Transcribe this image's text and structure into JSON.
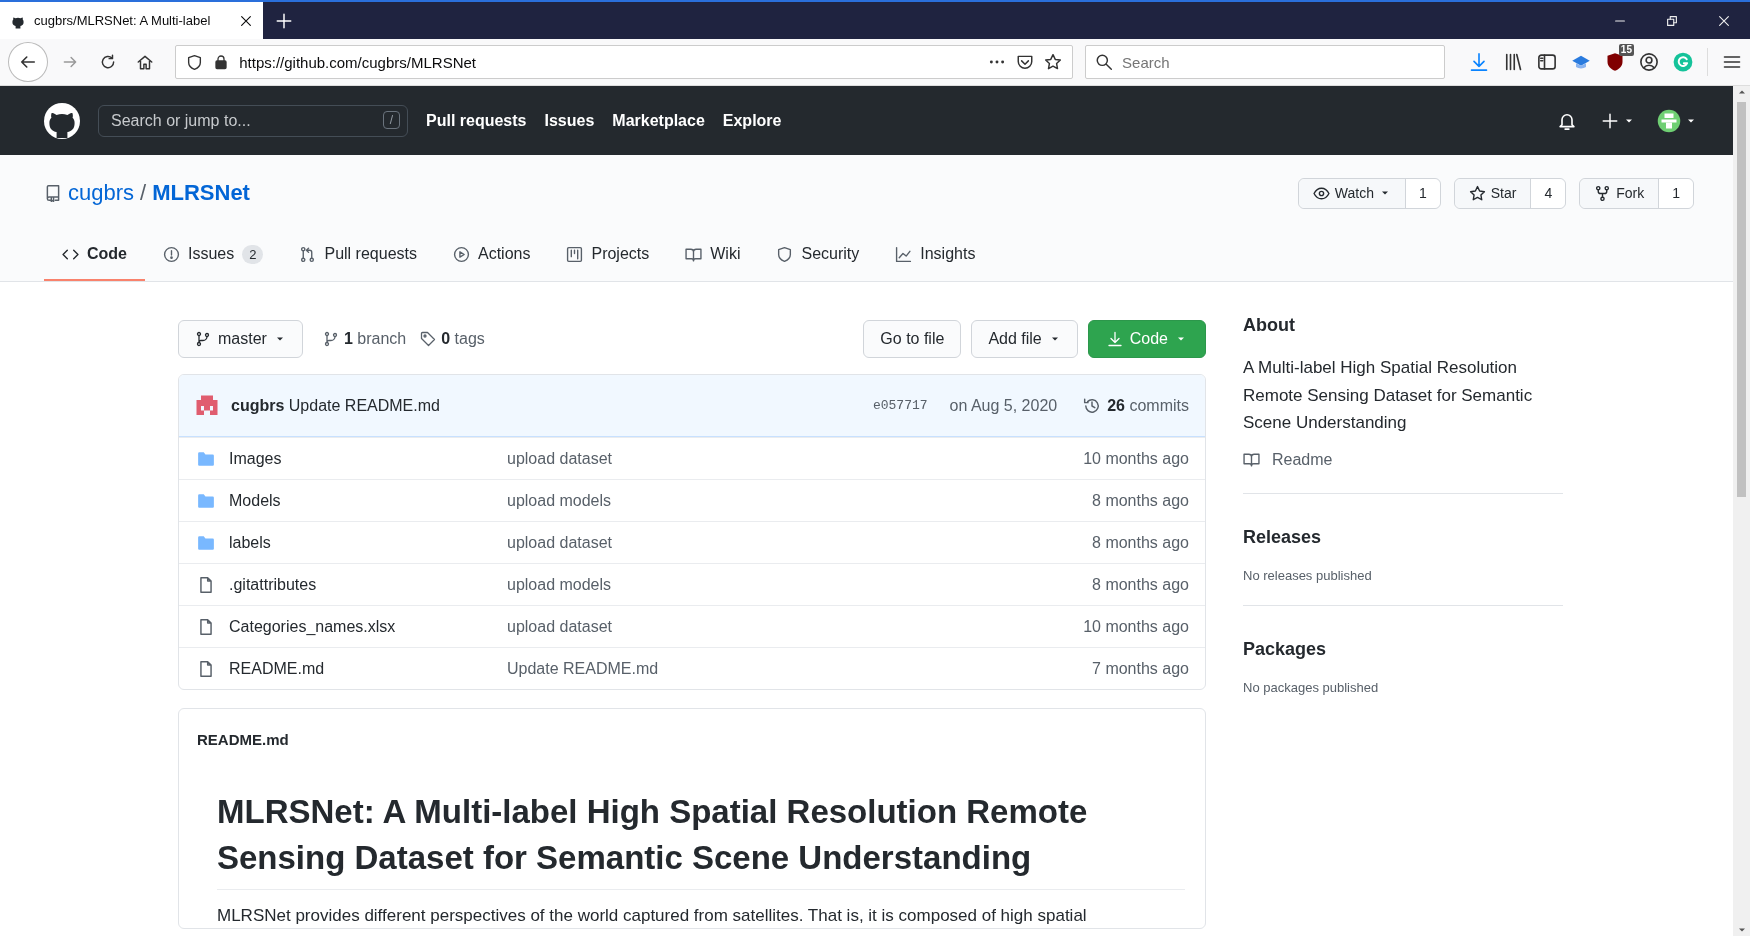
{
  "browser": {
    "tabs": [
      {
        "title": "cugbrs/MLRSNet: A Multi-label",
        "selected": true
      }
    ],
    "url": "https://github.com/cugbrs/MLRSNet",
    "search_placeholder": "Search",
    "extension_badge": "15"
  },
  "header": {
    "search_placeholder": "Search or jump to...",
    "search_key": "/",
    "nav": [
      "Pull requests",
      "Issues",
      "Marketplace",
      "Explore"
    ]
  },
  "repo": {
    "owner": "cugbrs",
    "separator": "/",
    "name": "MLRSNet",
    "actions": [
      {
        "label": "Watch",
        "count": "1"
      },
      {
        "label": "Star",
        "count": "4"
      },
      {
        "label": "Fork",
        "count": "1"
      }
    ],
    "tabs": [
      {
        "label": "Code",
        "selected": true
      },
      {
        "label": "Issues",
        "counter": "2",
        "selected": false
      },
      {
        "label": "Pull requests",
        "selected": false
      },
      {
        "label": "Actions",
        "selected": false
      },
      {
        "label": "Projects",
        "selected": false
      },
      {
        "label": "Wiki",
        "selected": false
      },
      {
        "label": "Security",
        "selected": false
      },
      {
        "label": "Insights",
        "selected": false
      }
    ]
  },
  "toolbar": {
    "branch": "master",
    "branches": "**1** branch",
    "tags": "**0** tags",
    "buttons": [
      {
        "label": "Go to file",
        "kind": "plain"
      },
      {
        "label": "Add file",
        "kind": "dropdown"
      },
      {
        "label": "Code",
        "kind": "primary"
      }
    ]
  },
  "commit": {
    "author": "cugbrs",
    "message": "Update README.md",
    "sha": "e057717",
    "date": "on Aug 5, 2020",
    "commits": "**26** commits"
  },
  "files": [
    {
      "name": "Images",
      "kind": "folder",
      "message": "upload dataset",
      "age": "10 months ago"
    },
    {
      "name": "Models",
      "kind": "folder",
      "message": "upload models",
      "age": "8 months ago"
    },
    {
      "name": "labels",
      "kind": "folder",
      "message": "upload dataset",
      "age": "8 months ago"
    },
    {
      "name": ".gitattributes",
      "kind": "file",
      "message": "upload models",
      "age": "8 months ago"
    },
    {
      "name": "Categories_names.xlsx",
      "kind": "file",
      "message": "upload dataset",
      "age": "10 months ago"
    },
    {
      "name": "README.md",
      "kind": "file",
      "message": "Update README.md",
      "age": "7 months ago"
    }
  ],
  "readme": {
    "filename": "README.md",
    "heading": "MLRSNet: A Multi-label High Spatial Resolution Remote Sensing Dataset for Semantic Scene Understanding",
    "paragraph": "MLRSNet provides different perspectives of the world captured from satellites. That is, it is composed of high spatial"
  },
  "about": {
    "title": "About",
    "description": "A Multi-label High Spatial Resolution Remote Sensing Dataset for Semantic Scene Understanding",
    "readme_link": "Readme",
    "sections": [
      {
        "title": "Releases",
        "text": "No releases published"
      },
      {
        "title": "Packages",
        "text": "No packages published"
      }
    ]
  }
}
